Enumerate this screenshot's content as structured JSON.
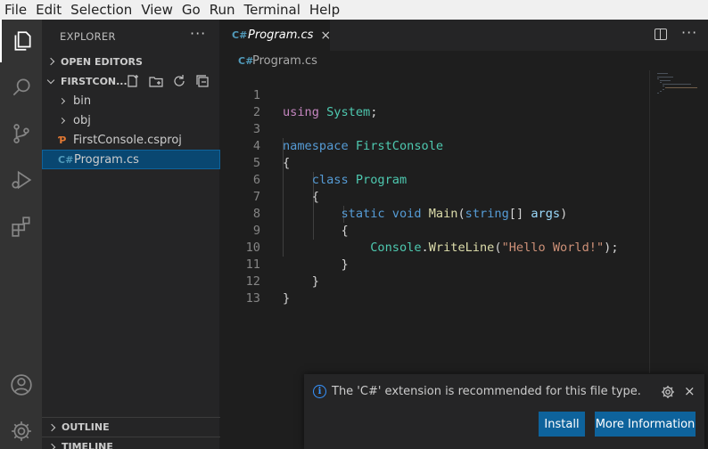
{
  "menu": [
    "File",
    "Edit",
    "Selection",
    "View",
    "Go",
    "Run",
    "Terminal",
    "Help"
  ],
  "sidebar": {
    "title": "EXPLORER",
    "more": "···",
    "open_editors": "OPEN EDITORS",
    "project": "FIRSTCON...",
    "items": [
      {
        "label": "bin"
      },
      {
        "label": "obj"
      },
      {
        "label": "FirstConsole.csproj",
        "icon": "rss-icon"
      },
      {
        "label": "Program.cs",
        "icon": "csharp-icon"
      }
    ],
    "outline": "OUTLINE",
    "timeline": "TIMELINE"
  },
  "icons": {
    "csharp": "C#",
    "rss": "Ƥ"
  },
  "colors": {
    "accent_blue": "#0e639c",
    "selection": "#094771",
    "csharp_icon": "#519aba",
    "csproj_icon": "#e37933"
  },
  "editor": {
    "tab_label": "Program.cs",
    "tab_close": "×",
    "breadcrumb": "Program.cs",
    "lines": [
      "1",
      "2",
      "3",
      "4",
      "5",
      "6",
      "7",
      "8",
      "9",
      "10",
      "11",
      "12",
      "13"
    ],
    "code": {
      "l1_kw": "using",
      "l1_ns": "System",
      "l1_end": ";",
      "l3_kw": "namespace",
      "l3_name": "FirstConsole",
      "l4": "{",
      "l5_kw": "class",
      "l5_name": "Program",
      "l6": "{",
      "l7_static": "static",
      "l7_void": "void",
      "l7_fn": "Main",
      "l7_open": "(",
      "l7_type": "string",
      "l7_arr": "[] ",
      "l7_param": "args",
      "l7_close": ")",
      "l8": "{",
      "l9_cls": "Console",
      "l9_dot": ".",
      "l9_fn": "WriteLine",
      "l9_open": "(",
      "l9_str": "\"Hello World!\"",
      "l9_close": ");",
      "l10": "}",
      "l11": "}",
      "l12": "}"
    }
  },
  "notification": {
    "message": "The 'C#' extension is recommended for this file type.",
    "install": "Install",
    "more_info": "More Information",
    "close": "×"
  }
}
